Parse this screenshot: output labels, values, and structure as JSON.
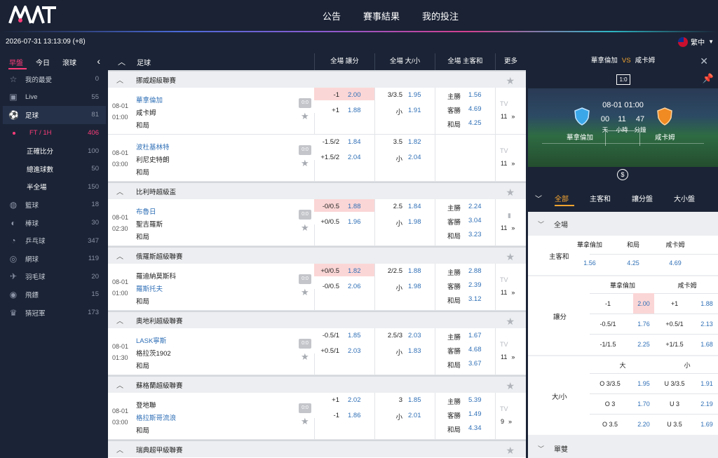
{
  "header": {
    "logo_text": "MT",
    "nav": [
      "公告",
      "賽事結果",
      "我的投注"
    ],
    "datetime": "2026-07-31 13:13:09 (+8)",
    "language": "繁中"
  },
  "sidebar": {
    "tabs": [
      "早盤",
      "今日",
      "滾球"
    ],
    "active_tab": "早盤",
    "items": [
      {
        "label": "我的最愛",
        "count": "0",
        "icon": "star-icon"
      },
      {
        "label": "Live",
        "count": "55",
        "icon": "tv-icon"
      },
      {
        "label": "足球",
        "count": "81",
        "icon": "soccer-ball-icon"
      },
      {
        "label": "FT / 1H",
        "count": "406",
        "icon": "dot-icon"
      },
      {
        "label": "正確比分",
        "count": "100",
        "icon": ""
      },
      {
        "label": "總進球數",
        "count": "50",
        "icon": ""
      },
      {
        "label": "半全場",
        "count": "150",
        "icon": ""
      },
      {
        "label": "籃球",
        "count": "18",
        "icon": "basketball-icon"
      },
      {
        "label": "棒球",
        "count": "30",
        "icon": "baseball-icon"
      },
      {
        "label": "乒乓球",
        "count": "347",
        "icon": "table-tennis-icon"
      },
      {
        "label": "網球",
        "count": "119",
        "icon": "tennis-icon"
      },
      {
        "label": "羽毛球",
        "count": "20",
        "icon": "badminton-icon"
      },
      {
        "label": "飛鏢",
        "count": "15",
        "icon": "darts-icon"
      },
      {
        "label": "猜冠軍",
        "count": "173",
        "icon": "crown-icon"
      }
    ]
  },
  "main": {
    "sport": "足球",
    "columns": [
      "全場 讓分",
      "全場 大/小",
      "全場 主客和",
      "更多"
    ],
    "leagues": [
      {
        "name": "挪威超級聯賽",
        "matches": [
          {
            "date": "08-01",
            "time": "01:00",
            "home": "華拿倫加",
            "away": "咸卡姆",
            "draw": "和局",
            "fav": "home",
            "score": "0:0",
            "hdp": [
              {
                "line": "-1",
                "odd": "2.00",
                "hl": true
              },
              {
                "line": "+1",
                "odd": "1.88",
                "hl": false
              }
            ],
            "ou": [
              {
                "line": "3/3.5",
                "odd": "1.95"
              },
              {
                "line": "小",
                "odd": "1.91"
              }
            ],
            "ml": [
              {
                "label": "主勝",
                "odd": "1.56"
              },
              {
                "label": "客勝",
                "odd": "4.69"
              },
              {
                "label": "和局",
                "odd": "4.25"
              }
            ],
            "tv": "TV",
            "more": "11"
          },
          {
            "date": "08-01",
            "time": "03:00",
            "home": "波杜基林特",
            "away": "利尼史特朗",
            "draw": "和局",
            "fav": "home",
            "score": "0:0",
            "hdp": [
              {
                "line": "-1.5/2",
                "odd": "1.84",
                "hl": false
              },
              {
                "line": "+1.5/2",
                "odd": "2.04",
                "hl": false
              }
            ],
            "ou": [
              {
                "line": "3.5",
                "odd": "1.82"
              },
              {
                "line": "小",
                "odd": "2.04"
              }
            ],
            "ml": [],
            "tv": "TV",
            "more": "11"
          }
        ]
      },
      {
        "name": "比利時超級盃",
        "matches": [
          {
            "date": "08-01",
            "time": "02:30",
            "home": "布魯日",
            "away": "聖吉羅斯",
            "draw": "和局",
            "fav": "home",
            "score": "0:0",
            "hdp": [
              {
                "line": "-0/0.5",
                "odd": "1.88",
                "hl": true
              },
              {
                "line": "+0/0.5",
                "odd": "1.96",
                "hl": false
              }
            ],
            "ou": [
              {
                "line": "2.5",
                "odd": "1.84"
              },
              {
                "line": "小",
                "odd": "1.98"
              }
            ],
            "ml": [
              {
                "label": "主勝",
                "odd": "2.24"
              },
              {
                "label": "客勝",
                "odd": "3.04"
              },
              {
                "label": "和局",
                "odd": "3.23"
              }
            ],
            "tv": "",
            "more": "11"
          }
        ]
      },
      {
        "name": "俄羅斯超級聯賽",
        "matches": [
          {
            "date": "08-01",
            "time": "01:00",
            "home": "羅迪納莫斯科",
            "away": "羅斯托夫",
            "draw": "和局",
            "fav": "away",
            "score": "0:0",
            "hdp": [
              {
                "line": "+0/0.5",
                "odd": "1.82",
                "hl": true
              },
              {
                "line": "-0/0.5",
                "odd": "2.06",
                "hl": false
              }
            ],
            "ou": [
              {
                "line": "2/2.5",
                "odd": "1.88"
              },
              {
                "line": "小",
                "odd": "1.98"
              }
            ],
            "ml": [
              {
                "label": "主勝",
                "odd": "2.88"
              },
              {
                "label": "客勝",
                "odd": "2.39"
              },
              {
                "label": "和局",
                "odd": "3.12"
              }
            ],
            "tv": "TV",
            "more": "11"
          }
        ]
      },
      {
        "name": "奧地利超級聯賽",
        "matches": [
          {
            "date": "08-01",
            "time": "01:30",
            "home": "LASK寧斯",
            "away": "格拉茨1902",
            "draw": "和局",
            "fav": "home",
            "score": "0:0",
            "hdp": [
              {
                "line": "-0.5/1",
                "odd": "1.85",
                "hl": false
              },
              {
                "line": "+0.5/1",
                "odd": "2.03",
                "hl": false
              }
            ],
            "ou": [
              {
                "line": "2.5/3",
                "odd": "2.03"
              },
              {
                "line": "小",
                "odd": "1.83"
              }
            ],
            "ml": [
              {
                "label": "主勝",
                "odd": "1.67"
              },
              {
                "label": "客勝",
                "odd": "4.68"
              },
              {
                "label": "和局",
                "odd": "3.67"
              }
            ],
            "tv": "TV",
            "more": "11"
          }
        ]
      },
      {
        "name": "蘇格蘭超級聯賽",
        "matches": [
          {
            "date": "08-01",
            "time": "03:00",
            "home": "登地聯",
            "away": "格拉斯哥流浪",
            "draw": "和局",
            "fav": "away",
            "score": "0:0",
            "hdp": [
              {
                "line": "+1",
                "odd": "2.02",
                "hl": false
              },
              {
                "line": "-1",
                "odd": "1.86",
                "hl": false
              }
            ],
            "ou": [
              {
                "line": "3",
                "odd": "1.85"
              },
              {
                "line": "小",
                "odd": "2.01"
              }
            ],
            "ml": [
              {
                "label": "主勝",
                "odd": "5.39"
              },
              {
                "label": "客勝",
                "odd": "1.49"
              },
              {
                "label": "和局",
                "odd": "4.34"
              }
            ],
            "tv": "TV",
            "more": "9"
          }
        ]
      },
      {
        "name": "瑞典超甲級聯賽",
        "matches": []
      }
    ]
  },
  "detail": {
    "home": "華拿倫加",
    "vs": "VS",
    "away": "咸卡姆",
    "score": "1:0",
    "kickoff": "08-01 01:00",
    "countdown": [
      {
        "value": "00",
        "unit": "天"
      },
      {
        "value": "11",
        "unit": "小時"
      },
      {
        "value": "47",
        "unit": "分鐘"
      }
    ],
    "tabs": [
      "全部",
      "主客和",
      "讓分盤",
      "大小盤"
    ],
    "active_tab": "全部",
    "section_full": "全場",
    "section_next": "單雙",
    "ml": {
      "label": "主客和",
      "headers": [
        "華拿倫加",
        "和局",
        "咸卡姆"
      ],
      "odds": [
        "1.56",
        "4.25",
        "4.69"
      ]
    },
    "hdp": {
      "label": "讓分",
      "headers": [
        "華拿倫加",
        "咸卡姆"
      ],
      "rows": [
        {
          "hl": "-1",
          "ho": "2.00",
          "al": "+1",
          "ao": "1.88",
          "highlight": true
        },
        {
          "hl": "-0.5/1",
          "ho": "1.76",
          "al": "+0.5/1",
          "ao": "2.13",
          "highlight": false
        },
        {
          "hl": "-1/1.5",
          "ho": "2.25",
          "al": "+1/1.5",
          "ao": "1.68",
          "highlight": false
        }
      ]
    },
    "ou": {
      "label": "大/小",
      "headers": [
        "大",
        "小"
      ],
      "rows": [
        {
          "ol": "O 3/3.5",
          "oo": "1.95",
          "ul": "U 3/3.5",
          "uo": "1.91"
        },
        {
          "ol": "O 3",
          "oo": "1.70",
          "ul": "U 3",
          "uo": "2.19"
        },
        {
          "ol": "O 3.5",
          "oo": "2.20",
          "ul": "U 3.5",
          "uo": "1.69"
        }
      ]
    }
  }
}
